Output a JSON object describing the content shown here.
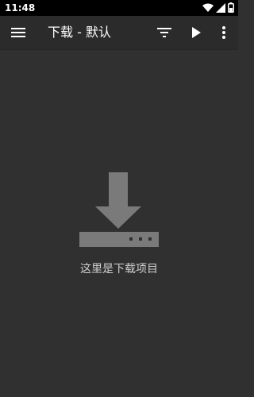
{
  "status_bar": {
    "time": "11:48",
    "icons": [
      "wifi-icon",
      "signal-icon",
      "battery-icon"
    ]
  },
  "toolbar": {
    "menu_icon": "hamburger-menu-icon",
    "title": "下载 - 默认",
    "filter_icon": "filter-icon",
    "play_icon": "play-icon",
    "more_icon": "more-vert-icon"
  },
  "empty_state": {
    "icon": "download-icon",
    "message": "这里是下载项目"
  },
  "colors": {
    "background": "#303030",
    "toolbar": "#2b2b2b",
    "status_bar": "#000000",
    "icon_gray": "#7a7a7a",
    "text_light": "#cfcfcf"
  }
}
